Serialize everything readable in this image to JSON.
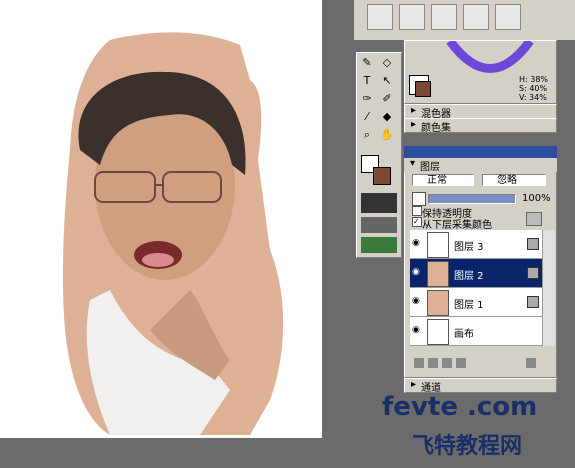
{
  "colors": {
    "skin": "#deb196",
    "canvas_bg": "#ffffff",
    "workspace": "#6b6b6b",
    "panel": "#d4d0c8",
    "selection": "#0a246a",
    "titlebar": "#2b4f9e"
  },
  "color_readout": {
    "h": "H: 38%",
    "s": "S: 40%",
    "v": "V: 34%"
  },
  "panels": {
    "mixer": "混色器",
    "color_set": "颜色集",
    "layers": "图层",
    "channels": "通道"
  },
  "layer_panel": {
    "blend_mode": "正常",
    "blend_alt": "忽略",
    "opacity": "100%",
    "preserve_transparency": "保持透明度",
    "pick_color_below": "从下层采集颜色",
    "layers": [
      {
        "name": "图层 3",
        "selected": false,
        "thumb": "blank"
      },
      {
        "name": "图层 2",
        "selected": true,
        "thumb": "face"
      },
      {
        "name": "图层 1",
        "selected": false,
        "thumb": "skin"
      },
      {
        "name": "画布",
        "selected": false,
        "thumb": "blank"
      }
    ]
  },
  "toolbox": {
    "tools": [
      "pen-icon",
      "text-icon",
      "brush-icon",
      "dropper-icon",
      "magnify-icon",
      "pointer-icon",
      "eraser-icon",
      "paint-bucket-icon",
      "hand-icon"
    ]
  },
  "watermark": {
    "line1": "fevte .com",
    "line2": "飞特教程网"
  }
}
